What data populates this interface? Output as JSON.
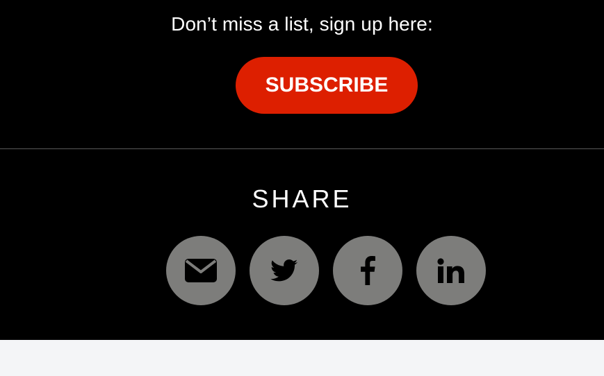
{
  "subscribe": {
    "prompt": "Don’t miss a list, sign up here:",
    "button_label": "SUBSCRIBE"
  },
  "share": {
    "heading": "SHARE",
    "buttons": [
      {
        "icon": "email-icon",
        "label": "Email"
      },
      {
        "icon": "twitter-icon",
        "label": "Twitter"
      },
      {
        "icon": "facebook-icon",
        "label": "Facebook"
      },
      {
        "icon": "linkedin-icon",
        "label": "LinkedIn"
      }
    ]
  },
  "colors": {
    "background": "#000000",
    "accent": "#dd1f00",
    "share_button_bg": "#7d7d7b",
    "icon": "#000000",
    "footer": "#f4f5f7"
  }
}
